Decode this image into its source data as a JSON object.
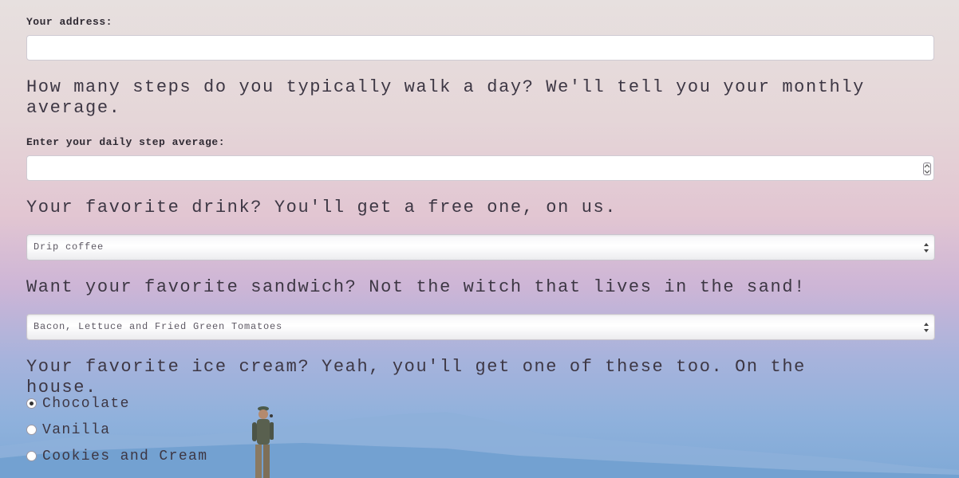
{
  "address": {
    "label": "Your address:",
    "value": ""
  },
  "steps": {
    "question": "How many steps do you typically walk a day? We'll tell you your monthly average.",
    "label": "Enter your daily step average:",
    "value": ""
  },
  "drink": {
    "question": "Your favorite drink? You'll get a free one, on us.",
    "selected": "Drip coffee"
  },
  "sandwich": {
    "question": "Want your favorite sandwich? Not the witch that lives in the sand!",
    "selected": "Bacon, Lettuce and Fried Green Tomatoes"
  },
  "ice_cream": {
    "question": "Your favorite ice cream? Yeah, you'll get one of these too. On the house.",
    "options": [
      {
        "label": "Chocolate",
        "checked": true
      },
      {
        "label": "Vanilla",
        "checked": false
      },
      {
        "label": "Cookies and Cream",
        "checked": false
      }
    ]
  },
  "colors": {
    "background_top": "#e7e0df",
    "background_mid": "#e2c6d2",
    "background_bottom": "#7fa9d6",
    "mountains": "#6f9fcf"
  },
  "icons": {
    "select_arrows": "updown-arrows-icon",
    "number_stepper": "stepper-icon"
  }
}
